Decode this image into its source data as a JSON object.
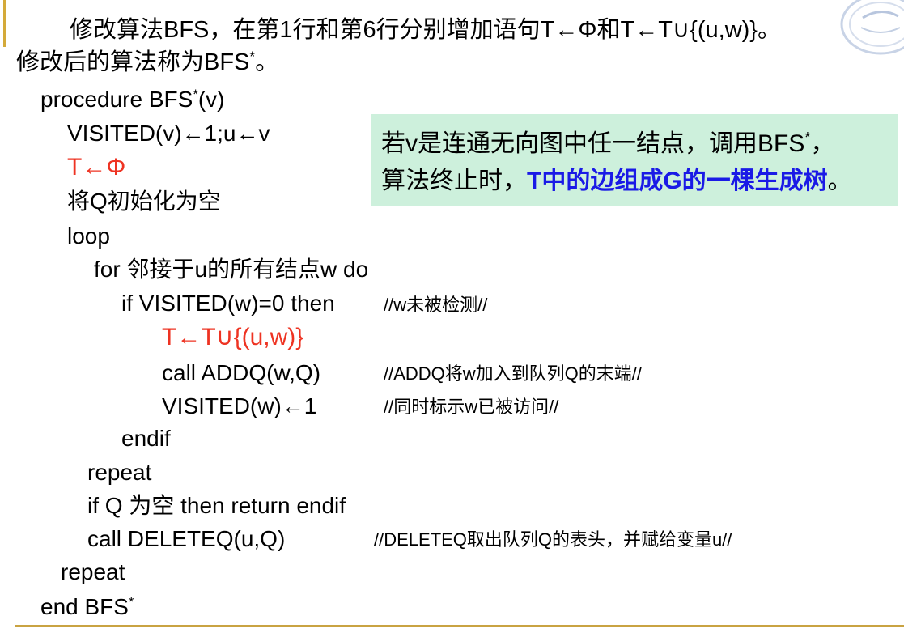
{
  "intro": {
    "line1": "修改算法BFS，在第1行和第6行分别增加语句T←Φ和T←T∪{(u,w)}。",
    "line2_text": "修改后的算法称为BFS",
    "line2_sup": "*",
    "line2_end": "。"
  },
  "code": {
    "proc_head": "procedure BFS",
    "proc_sup": "*",
    "proc_tail": "(v)",
    "l1": "VISITED(v)←1;u←v",
    "l2": "T←Φ",
    "l3": "将Q初始化为空",
    "l4": "loop",
    "l5": "for 邻接于u的所有结点w do",
    "l6": "if VISITED(w)=0 then",
    "l6_comment": "//w未被检测//",
    "l7": "T←T∪{(u,w)}",
    "l8": "call ADDQ(w,Q)",
    "l8_comment": "//ADDQ将w加入到队列Q的末端//",
    "l9": "VISITED(w)←1",
    "l9_comment": "//同时标示w已被访问//",
    "l10": "endif",
    "l11": "repeat",
    "l12": "if Q 为空 then return endif",
    "l13": "call DELETEQ(u,Q)",
    "l13_comment": "//DELETEQ取出队列Q的表头，并赋给变量u//",
    "l14": "repeat",
    "end_head": "end BFS",
    "end_sup": "*"
  },
  "callout": {
    "line1_text": "若v是连通无向图中任一结点，调用BFS",
    "line1_sup": "*",
    "line1_end": "，",
    "line2_plain": "算法终止时，",
    "line2_highlight": "T中的边组成G的一棵生成树",
    "line2_end": "。"
  },
  "colors": {
    "inserted_code": "#ee3322",
    "highlight_text": "#1a1ae6",
    "callout_bg": "#cdf0dc",
    "rule": "#c9a342"
  }
}
